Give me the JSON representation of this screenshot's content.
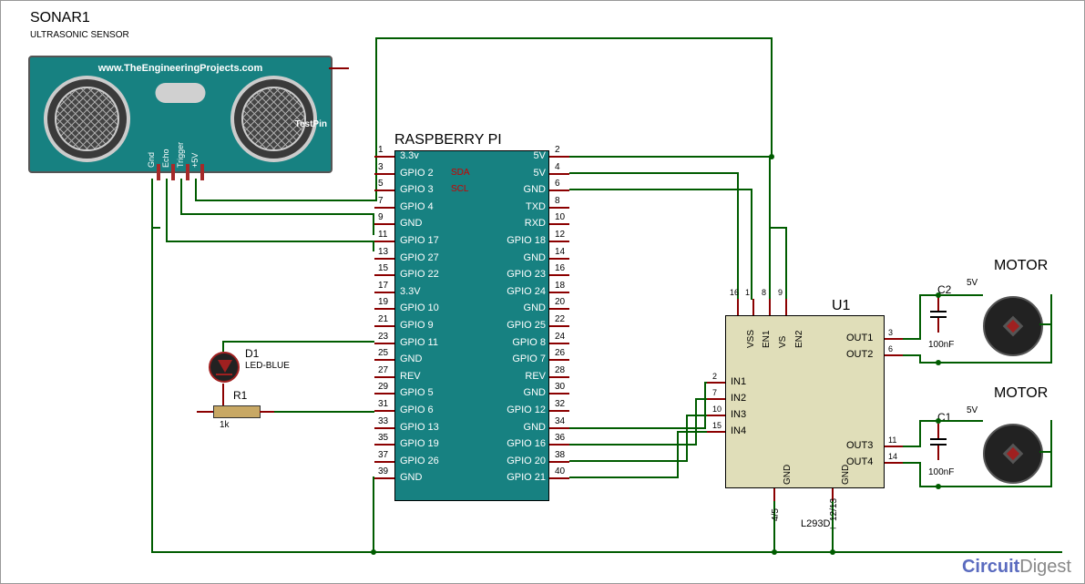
{
  "diagram": {
    "title": "SONAR1",
    "subtitle": "ULTRASONIC SENSOR",
    "sonar_url": "www.TheEngineeringProjects.com",
    "testpin_label": "TestPin",
    "sonar_pins": [
      "Gnd",
      "Echo",
      "Trigger",
      "+5V"
    ],
    "rpi_title": "RASPBERRY PI",
    "rpi_left": [
      {
        "num": "1",
        "name": "3.3v"
      },
      {
        "num": "3",
        "name": "GPIO 2",
        "alt": "SDA"
      },
      {
        "num": "5",
        "name": "GPIO 3",
        "alt": "SCL"
      },
      {
        "num": "7",
        "name": "GPIO 4"
      },
      {
        "num": "9",
        "name": "GND"
      },
      {
        "num": "11",
        "name": "GPIO 17"
      },
      {
        "num": "13",
        "name": "GPIO 27"
      },
      {
        "num": "15",
        "name": "GPIO 22"
      },
      {
        "num": "17",
        "name": "3.3V"
      },
      {
        "num": "19",
        "name": "GPIO 10"
      },
      {
        "num": "21",
        "name": "GPIO 9"
      },
      {
        "num": "23",
        "name": "GPIO 11"
      },
      {
        "num": "25",
        "name": "GND"
      },
      {
        "num": "27",
        "name": "REV"
      },
      {
        "num": "29",
        "name": "GPIO 5"
      },
      {
        "num": "31",
        "name": "GPIO 6"
      },
      {
        "num": "33",
        "name": "GPIO 13"
      },
      {
        "num": "35",
        "name": "GPIO 19"
      },
      {
        "num": "37",
        "name": "GPIO 26"
      },
      {
        "num": "39",
        "name": "GND"
      }
    ],
    "rpi_right": [
      {
        "num": "2",
        "name": "5V"
      },
      {
        "num": "4",
        "name": "5V"
      },
      {
        "num": "6",
        "name": "GND"
      },
      {
        "num": "8",
        "name": "TXD"
      },
      {
        "num": "10",
        "name": "RXD"
      },
      {
        "num": "12",
        "name": "GPIO 18"
      },
      {
        "num": "14",
        "name": "GND"
      },
      {
        "num": "16",
        "name": "GPIO 23"
      },
      {
        "num": "18",
        "name": "GPIO 24"
      },
      {
        "num": "20",
        "name": "GND"
      },
      {
        "num": "22",
        "name": "GPIO 25"
      },
      {
        "num": "24",
        "name": "GPIO 8"
      },
      {
        "num": "26",
        "name": "GPIO 7"
      },
      {
        "num": "28",
        "name": "REV"
      },
      {
        "num": "30",
        "name": "GND"
      },
      {
        "num": "32",
        "name": "GPIO 12"
      },
      {
        "num": "34",
        "name": "GND"
      },
      {
        "num": "36",
        "name": "GPIO 16"
      },
      {
        "num": "38",
        "name": "GPIO 20"
      },
      {
        "num": "40",
        "name": "GPIO 21"
      }
    ],
    "driver_ref": "U1",
    "driver_name": "L293D_",
    "driver_left": [
      {
        "num": "2",
        "name": "IN1"
      },
      {
        "num": "7",
        "name": "IN2"
      },
      {
        "num": "10",
        "name": "IN3"
      },
      {
        "num": "15",
        "name": "IN4"
      }
    ],
    "driver_right": [
      {
        "num": "3",
        "name": "OUT1"
      },
      {
        "num": "6",
        "name": "OUT2"
      },
      {
        "num": "11",
        "name": "OUT3"
      },
      {
        "num": "14",
        "name": "OUT4"
      }
    ],
    "driver_top": [
      {
        "num": "16",
        "name": "VSS"
      },
      {
        "num": "1",
        "name": "EN1"
      },
      {
        "num": "8",
        "name": "VS"
      },
      {
        "num": "9",
        "name": "EN2"
      }
    ],
    "driver_bottom": [
      {
        "num": "4/5",
        "name": "GND"
      },
      {
        "num": "12/13",
        "name": "GND"
      }
    ],
    "motor_label": "MOTOR",
    "motor_volt": "5V",
    "cap2_ref": "C2",
    "cap1_ref": "C1",
    "cap_value": "100nF",
    "led_ref": "D1",
    "led_name": "LED-BLUE",
    "res_ref": "R1",
    "res_value": "1k",
    "footer_brand1": "Circuit",
    "footer_brand2": "Digest"
  }
}
